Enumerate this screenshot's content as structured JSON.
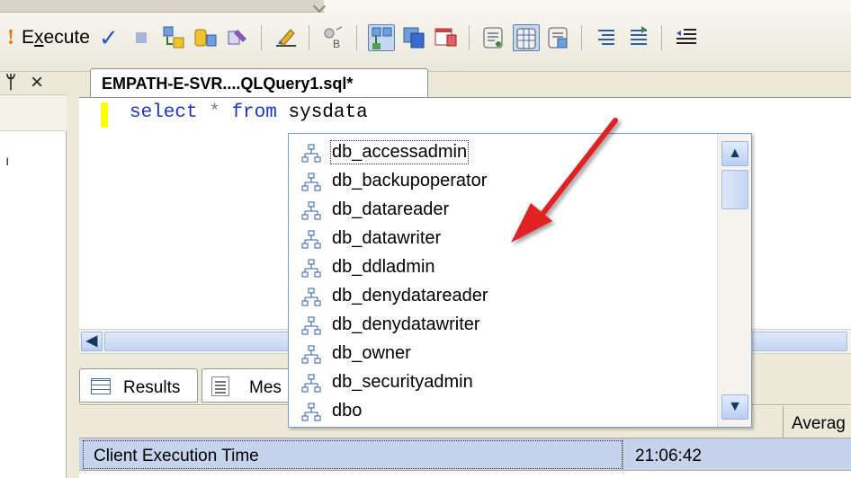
{
  "toolbar": {
    "execute_access_key": "x",
    "execute_label_rest": "ecute",
    "execute_label_prefix": "E"
  },
  "left_panel": {
    "fragment": "ı"
  },
  "editor": {
    "tab_title": "EMPATH-E-SVR....QLQuery1.sql*",
    "code": {
      "kw_select": "select",
      "op_star": "*",
      "kw_from": "from",
      "ident": "sysdata"
    }
  },
  "autocomplete": {
    "items": [
      {
        "label": "db_accessadmin"
      },
      {
        "label": "db_backupoperator"
      },
      {
        "label": "db_datareader"
      },
      {
        "label": "db_datawriter"
      },
      {
        "label": "db_ddladmin"
      },
      {
        "label": "db_denydatareader"
      },
      {
        "label": "db_denydatawriter"
      },
      {
        "label": "db_owner"
      },
      {
        "label": "db_securityadmin"
      },
      {
        "label": "dbo"
      }
    ],
    "scroll_up": "▲",
    "scroll_down": "▼"
  },
  "results": {
    "tabs": [
      {
        "label": "Results"
      },
      {
        "label": "Mes"
      }
    ],
    "columns": {
      "average": "Averag"
    },
    "rows": [
      {
        "label": "Client Execution Time",
        "value": "21:06:42"
      }
    ]
  },
  "hscroll": {
    "left_arrow": "◀"
  },
  "colors": {
    "keyword": "#1c32c8",
    "annotation_arrow": "#e02020",
    "selection_row": "#c5d3ec"
  }
}
